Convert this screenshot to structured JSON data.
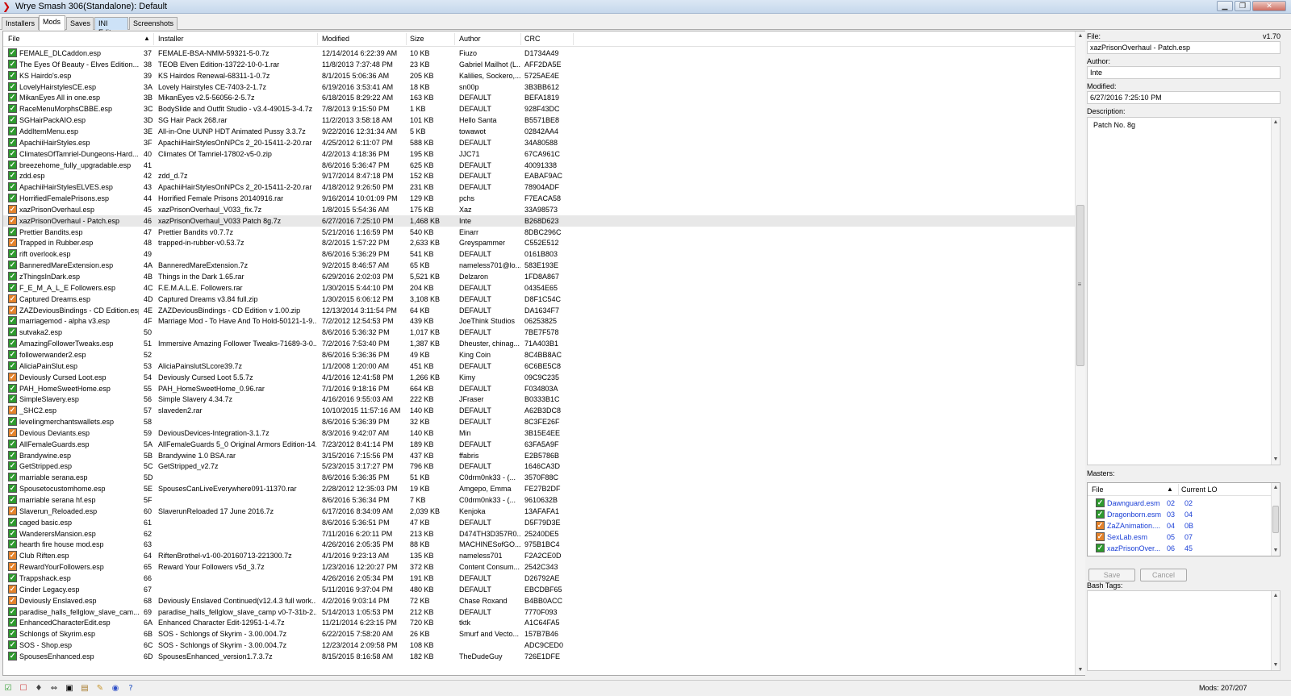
{
  "window": {
    "title": "Wrye Smash 306(Standalone): Default"
  },
  "tabs": [
    {
      "label": "Installers",
      "active": false
    },
    {
      "label": "Mods",
      "active": true
    },
    {
      "label": "Saves",
      "active": false
    },
    {
      "label": "INI Edits",
      "active": false,
      "highlight": true
    },
    {
      "label": "Screenshots",
      "active": false
    }
  ],
  "columns": {
    "file": "File",
    "installer": "Installer",
    "modified": "Modified",
    "size": "Size",
    "author": "Author",
    "crc": "CRC"
  },
  "mods": [
    {
      "c": "g",
      "f": "FEMALE_DLCaddon.esp",
      "lo": "37",
      "i": "FEMALE-BSA-NMM-59321-5-0.7z",
      "m": "12/14/2014 6:22:39 AM",
      "s": "10 KB",
      "a": "Fiuzo",
      "crc": "D1734A49"
    },
    {
      "c": "g",
      "f": "The Eyes Of Beauty - Elves Edition...",
      "lo": "38",
      "i": "TEOB Elven Edition-13722-10-0-1.rar",
      "m": "11/8/2013 7:37:48 PM",
      "s": "23 KB",
      "a": "Gabriel Mailhot (L...",
      "crc": "AFF2DA5E"
    },
    {
      "c": "g",
      "f": "KS Hairdo's.esp",
      "lo": "39",
      "i": "KS Hairdos Renewal-68311-1-0.7z",
      "m": "8/1/2015 5:06:36 AM",
      "s": "205 KB",
      "a": "Kalilies, Sockero,...",
      "crc": "5725AE4E"
    },
    {
      "c": "g",
      "f": "LovelyHairstylesCE.esp",
      "lo": "3A",
      "i": "Lovely Hairstyles CE-7403-2-1.7z",
      "m": "6/19/2016 3:53:41 AM",
      "s": "18 KB",
      "a": "sn00p",
      "crc": "3B3BB612"
    },
    {
      "c": "g",
      "f": "MikanEyes All in one.esp",
      "lo": "3B",
      "i": "MikanEyes v2.5-56056-2-5.7z",
      "m": "6/18/2015 8:29:22 AM",
      "s": "163 KB",
      "a": "DEFAULT",
      "crc": "BEFA1819"
    },
    {
      "c": "g",
      "f": "RaceMenuMorphsCBBE.esp",
      "lo": "3C",
      "i": "BodySlide and Outfit Studio - v3.4-49015-3-4.7z",
      "m": "7/8/2013 9:15:50 PM",
      "s": "1 KB",
      "a": "DEFAULT",
      "crc": "928F43DC"
    },
    {
      "c": "g",
      "f": "SGHairPackAIO.esp",
      "lo": "3D",
      "i": "SG Hair Pack 268.rar",
      "m": "11/2/2013 3:58:18 AM",
      "s": "101 KB",
      "a": "Hello Santa",
      "crc": "B5571BE8"
    },
    {
      "c": "g",
      "f": "AddItemMenu.esp",
      "lo": "3E",
      "i": "All-in-One UUNP HDT Animated Pussy 3.3.7z",
      "m": "9/22/2016 12:31:34 AM",
      "s": "5 KB",
      "a": "towawot",
      "crc": "02842AA4"
    },
    {
      "c": "g",
      "f": "ApachiiHairStyles.esp",
      "lo": "3F",
      "i": "ApachiiHairStylesOnNPCs 2_20-15411-2-20.rar",
      "m": "4/25/2012 6:11:07 PM",
      "s": "588 KB",
      "a": "DEFAULT",
      "crc": "34A80588"
    },
    {
      "c": "g",
      "f": "ClimatesOfTamriel-Dungeons-Hard...",
      "lo": "40",
      "i": "Climates Of Tamriel-17802-v5-0.zip",
      "m": "4/2/2013 4:18:36 PM",
      "s": "195 KB",
      "a": "JJC71",
      "crc": "67CA961C"
    },
    {
      "c": "g",
      "f": "breezehome_fully_upgradable.esp",
      "lo": "41",
      "i": "",
      "m": "8/6/2016 5:36:47 PM",
      "s": "625 KB",
      "a": "DEFAULT",
      "crc": "40091338"
    },
    {
      "c": "g",
      "f": "zdd.esp",
      "lo": "42",
      "i": "zdd_d.7z",
      "m": "9/17/2014 8:47:18 PM",
      "s": "152 KB",
      "a": "DEFAULT",
      "crc": "EABAF9AC"
    },
    {
      "c": "g",
      "f": "ApachiiHairStylesELVES.esp",
      "lo": "43",
      "i": "ApachiiHairStylesOnNPCs 2_20-15411-2-20.rar",
      "m": "4/18/2012 9:26:50 PM",
      "s": "231 KB",
      "a": "DEFAULT",
      "crc": "78904ADF"
    },
    {
      "c": "g",
      "f": "HorrifiedFemalePrisons.esp",
      "lo": "44",
      "i": "Horrified Female Prisons 20140916.rar",
      "m": "9/16/2014 10:01:09 PM",
      "s": "129 KB",
      "a": "pchs",
      "crc": "F7EACA58"
    },
    {
      "c": "o",
      "f": "xazPrisonOverhaul.esp",
      "lo": "45",
      "i": "xazPrisonOverhaul_V033_fix.7z",
      "m": "1/8/2015 5:54:36 AM",
      "s": "175 KB",
      "a": "Xaz",
      "crc": "33A98573"
    },
    {
      "c": "o",
      "f": "xazPrisonOverhaul - Patch.esp",
      "lo": "46",
      "i": "xazPrisonOverhaul_V033 Patch 8g.7z",
      "m": "6/27/2016 7:25:10 PM",
      "s": "1,468 KB",
      "a": "Inte",
      "crc": "B268D623",
      "sel": true
    },
    {
      "c": "g",
      "f": "Prettier Bandits.esp",
      "lo": "47",
      "i": "Prettier Bandits v0.7.7z",
      "m": "5/21/2016 1:16:59 PM",
      "s": "540 KB",
      "a": "Einarr",
      "crc": "8DBC296C"
    },
    {
      "c": "o",
      "f": "Trapped in Rubber.esp",
      "lo": "48",
      "i": "trapped-in-rubber-v0.53.7z",
      "m": "8/2/2015 1:57:22 PM",
      "s": "2,633 KB",
      "a": "Greyspammer",
      "crc": "C552E512"
    },
    {
      "c": "g",
      "f": "rift overlook.esp",
      "lo": "49",
      "i": "",
      "m": "8/6/2016 5:36:29 PM",
      "s": "541 KB",
      "a": "DEFAULT",
      "crc": "0161B803"
    },
    {
      "c": "g",
      "f": "BanneredMareExtension.esp",
      "lo": "4A",
      "i": "BanneredMareExtension.7z",
      "m": "9/2/2015 8:46:57 AM",
      "s": "65 KB",
      "a": "nameless701@lo...",
      "crc": "583E193E"
    },
    {
      "c": "g",
      "f": "zThingsInDark.esp",
      "lo": "4B",
      "i": "Things in the Dark 1.65.rar",
      "m": "6/29/2016 2:02:03 PM",
      "s": "5,521 KB",
      "a": "Delzaron",
      "crc": "1FD8A867"
    },
    {
      "c": "g",
      "f": "F_E_M_A_L_E Followers.esp",
      "lo": "4C",
      "i": "F.E.M.A.L.E. Followers.rar",
      "m": "1/30/2015 5:44:10 PM",
      "s": "204 KB",
      "a": "DEFAULT",
      "crc": "04354E65"
    },
    {
      "c": "o",
      "f": "Captured Dreams.esp",
      "lo": "4D",
      "i": "Captured Dreams v3.84 full.zip",
      "m": "1/30/2015 6:06:12 PM",
      "s": "3,108 KB",
      "a": "DEFAULT",
      "crc": "D8F1C54C"
    },
    {
      "c": "o",
      "f": "ZAZDeviousBindings - CD Edition.esp",
      "lo": "4E",
      "i": "ZAZDeviousBindings - CD Edition v 1.00.zip",
      "m": "12/13/2014 3:11:54 PM",
      "s": "64 KB",
      "a": "DEFAULT",
      "crc": "DA1634F7"
    },
    {
      "c": "g",
      "f": "marriagemod - alpha v3.esp",
      "lo": "4F",
      "i": "Marriage Mod - To Have And To Hold-50121-1-9...",
      "m": "7/2/2012 12:54:53 PM",
      "s": "439 KB",
      "a": "JoeThink Studios",
      "crc": "06253825"
    },
    {
      "c": "g",
      "f": "sutvaka2.esp",
      "lo": "50",
      "i": "",
      "m": "8/6/2016 5:36:32 PM",
      "s": "1,017 KB",
      "a": "DEFAULT",
      "crc": "7BE7F578"
    },
    {
      "c": "g",
      "f": "AmazingFollowerTweaks.esp",
      "lo": "51",
      "i": "Immersive Amazing Follower Tweaks-71689-3-0...",
      "m": "7/2/2016 7:53:40 PM",
      "s": "1,387 KB",
      "a": "Dheuster, chinag...",
      "crc": "71A403B1"
    },
    {
      "c": "g",
      "f": "followerwander2.esp",
      "lo": "52",
      "i": "",
      "m": "8/6/2016 5:36:36 PM",
      "s": "49 KB",
      "a": "King Coin",
      "crc": "8C4BB8AC"
    },
    {
      "c": "g",
      "f": "AliciaPainSlut.esp",
      "lo": "53",
      "i": "AliciaPainslutSLcore39.7z",
      "m": "1/1/2008 1:20:00 AM",
      "s": "451 KB",
      "a": "DEFAULT",
      "crc": "6C6BE5C8"
    },
    {
      "c": "o",
      "f": "Deviously Cursed Loot.esp",
      "lo": "54",
      "i": "Deviously Cursed Loot 5.5.7z",
      "m": "4/1/2016 12:41:58 PM",
      "s": "1,266 KB",
      "a": "Kimy",
      "crc": "09C9C235"
    },
    {
      "c": "g",
      "f": "PAH_HomeSweetHome.esp",
      "lo": "55",
      "i": "PAH_HomeSweetHome_0.96.rar",
      "m": "7/1/2016 9:18:16 PM",
      "s": "664 KB",
      "a": "DEFAULT",
      "crc": "F034803A"
    },
    {
      "c": "g",
      "f": "SimpleSlavery.esp",
      "lo": "56",
      "i": "Simple Slavery 4.34.7z",
      "m": "4/16/2016 9:55:03 AM",
      "s": "222 KB",
      "a": "JFraser",
      "crc": "B0333B1C"
    },
    {
      "c": "o",
      "f": "_SHC2.esp",
      "lo": "57",
      "i": "slaveden2.rar",
      "m": "10/10/2015 11:57:16 AM",
      "s": "140 KB",
      "a": "DEFAULT",
      "crc": "A62B3DC8"
    },
    {
      "c": "g",
      "f": "levelingmerchantswallets.esp",
      "lo": "58",
      "i": "",
      "m": "8/6/2016 5:36:39 PM",
      "s": "32 KB",
      "a": "DEFAULT",
      "crc": "8C3FE26F"
    },
    {
      "c": "o",
      "f": "Devious Deviants.esp",
      "lo": "59",
      "i": "DeviousDevices-Integration-3.1.7z",
      "m": "8/3/2016 9:42:07 AM",
      "s": "140 KB",
      "a": "Min",
      "crc": "3B15E4EE"
    },
    {
      "c": "g",
      "f": "AllFemaleGuards.esp",
      "lo": "5A",
      "i": "AllFemaleGuards 5_0 Original Armors Edition-14...",
      "m": "7/23/2012 8:41:14 PM",
      "s": "189 KB",
      "a": "DEFAULT",
      "crc": "63FA5A9F"
    },
    {
      "c": "g",
      "f": "Brandywine.esp",
      "lo": "5B",
      "i": "Brandywine 1.0 BSA.rar",
      "m": "3/15/2016 7:15:56 PM",
      "s": "437 KB",
      "a": "ffabris",
      "crc": "E2B5786B"
    },
    {
      "c": "g",
      "f": "GetStripped.esp",
      "lo": "5C",
      "i": "GetStripped_v2.7z",
      "m": "5/23/2015 3:17:27 PM",
      "s": "796 KB",
      "a": "DEFAULT",
      "crc": "1646CA3D"
    },
    {
      "c": "g",
      "f": "marriable serana.esp",
      "lo": "5D",
      "i": "",
      "m": "8/6/2016 5:36:35 PM",
      "s": "51 KB",
      "a": "C0drm0nk33 - (...",
      "crc": "3570F88C"
    },
    {
      "c": "g",
      "f": "Spousetocustomhome.esp",
      "lo": "5E",
      "i": "SpousesCanLiveEverywhere091-11370.rar",
      "m": "2/28/2012 12:35:03 PM",
      "s": "19 KB",
      "a": "Amgepo, Emma",
      "crc": "FE27B2DF"
    },
    {
      "c": "g",
      "f": "marriable serana hf.esp",
      "lo": "5F",
      "i": "",
      "m": "8/6/2016 5:36:34 PM",
      "s": "7 KB",
      "a": "C0drm0nk33 - (...",
      "crc": "9610632B"
    },
    {
      "c": "o",
      "f": "Slaverun_Reloaded.esp",
      "lo": "60",
      "i": "SlaverunReloaded 17 June 2016.7z",
      "m": "6/17/2016 8:34:09 AM",
      "s": "2,039 KB",
      "a": "Kenjoka",
      "crc": "13AFAFA1"
    },
    {
      "c": "g",
      "f": "caged basic.esp",
      "lo": "61",
      "i": "",
      "m": "8/6/2016 5:36:51 PM",
      "s": "47 KB",
      "a": "DEFAULT",
      "crc": "D5F79D3E"
    },
    {
      "c": "g",
      "f": "WanderersMansion.esp",
      "lo": "62",
      "i": "",
      "m": "7/11/2016 6:20:11 PM",
      "s": "213 KB",
      "a": "D474TH3D357R0...",
      "crc": "25240DE5"
    },
    {
      "c": "g",
      "f": "hearth fire house mod.esp",
      "lo": "63",
      "i": "",
      "m": "4/26/2016 2:05:35 PM",
      "s": "88 KB",
      "a": "MACHINESofGO...",
      "crc": "975B1BC4"
    },
    {
      "c": "o",
      "f": "Club Riften.esp",
      "lo": "64",
      "i": "RiftenBrothel-v1-00-20160713-221300.7z",
      "m": "4/1/2016 9:23:13 AM",
      "s": "135 KB",
      "a": "nameless701",
      "crc": "F2A2CE0D"
    },
    {
      "c": "o",
      "f": "RewardYourFollowers.esp",
      "lo": "65",
      "i": "Reward Your Followers v5d_3.7z",
      "m": "1/23/2016 12:20:27 PM",
      "s": "372 KB",
      "a": "Content Consum...",
      "crc": "2542C343"
    },
    {
      "c": "g",
      "f": "Trappshack.esp",
      "lo": "66",
      "i": "",
      "m": "4/26/2016 2:05:34 PM",
      "s": "191 KB",
      "a": "DEFAULT",
      "crc": "D26792AE"
    },
    {
      "c": "o",
      "f": "Cinder Legacy.esp",
      "lo": "67",
      "i": "",
      "m": "5/11/2016 9:37:04 PM",
      "s": "480 KB",
      "a": "DEFAULT",
      "crc": "EBCDBF65"
    },
    {
      "c": "o",
      "f": "Deviously Enslaved.esp",
      "lo": "68",
      "i": "Deviously Enslaved Continued(v12.4.3 full work...",
      "m": "4/2/2016 9:03:14 PM",
      "s": "72 KB",
      "a": "Chase Roxand",
      "crc": "B4BB0ACC"
    },
    {
      "c": "g",
      "f": "paradise_halls_fellglow_slave_cam...",
      "lo": "69",
      "i": "paradise_halls_fellglow_slave_camp v0-7-31b-2...",
      "m": "5/14/2013 1:05:53 PM",
      "s": "212 KB",
      "a": "DEFAULT",
      "crc": "7770F093"
    },
    {
      "c": "g",
      "f": "EnhancedCharacterEdit.esp",
      "lo": "6A",
      "i": "Enhanced Character Edit-12951-1-4.7z",
      "m": "11/21/2014 6:23:15 PM",
      "s": "720 KB",
      "a": "tktk",
      "crc": "A1C64FA5"
    },
    {
      "c": "g",
      "f": "Schlongs of Skyrim.esp",
      "lo": "6B",
      "i": "SOS - Schlongs of Skyrim - 3.00.004.7z",
      "m": "6/22/2015 7:58:20 AM",
      "s": "26 KB",
      "a": "Smurf and Vecto...",
      "crc": "157B7B46"
    },
    {
      "c": "g",
      "f": "SOS - Shop.esp",
      "lo": "6C",
      "i": "SOS - Schlongs of Skyrim - 3.00.004.7z",
      "m": "12/23/2014 2:09:58 PM",
      "s": "108 KB",
      "a": "",
      "crc": "ADC9CED0"
    },
    {
      "c": "g",
      "f": "SpousesEnhanced.esp",
      "lo": "6D",
      "i": "SpousesEnhanced_version1.7.3.7z",
      "m": "8/15/2015 8:16:58 AM",
      "s": "182 KB",
      "a": "TheDudeGuy",
      "crc": "726E1DFE"
    }
  ],
  "details": {
    "version": "v1.70",
    "file_label": "File:",
    "file": "xazPrisonOverhaul - Patch.esp",
    "author_label": "Author:",
    "author": "Inte",
    "modified_label": "Modified:",
    "modified": "6/27/2016 7:25:10 PM",
    "description_label": "Description:",
    "description": "Patch No. 8g",
    "masters_label": "Masters:",
    "masters_columns": {
      "file": "File",
      "current_lo": "Current LO"
    },
    "masters": [
      {
        "c": "g",
        "f": "Dawnguard.esm",
        "a": "02",
        "b": "02"
      },
      {
        "c": "g",
        "f": "Dragonborn.esm",
        "a": "03",
        "b": "04"
      },
      {
        "c": "o",
        "f": "ZaZAnimation....",
        "a": "04",
        "b": "0B"
      },
      {
        "c": "o",
        "f": "SexLab.esm",
        "a": "05",
        "b": "07"
      },
      {
        "c": "g",
        "f": "xazPrisonOver...",
        "a": "06",
        "b": "45"
      }
    ],
    "save_label": "Save",
    "cancel_label": "Cancel",
    "bash_tags_label": "Bash Tags:"
  },
  "status": {
    "mods_count": "Mods: 207/207"
  },
  "colors": {
    "checked_active": "#2e9a2e",
    "checked_warning": "#e4832c",
    "selected_row": "#e8e8e8",
    "master_link": "#1a3fd6"
  }
}
